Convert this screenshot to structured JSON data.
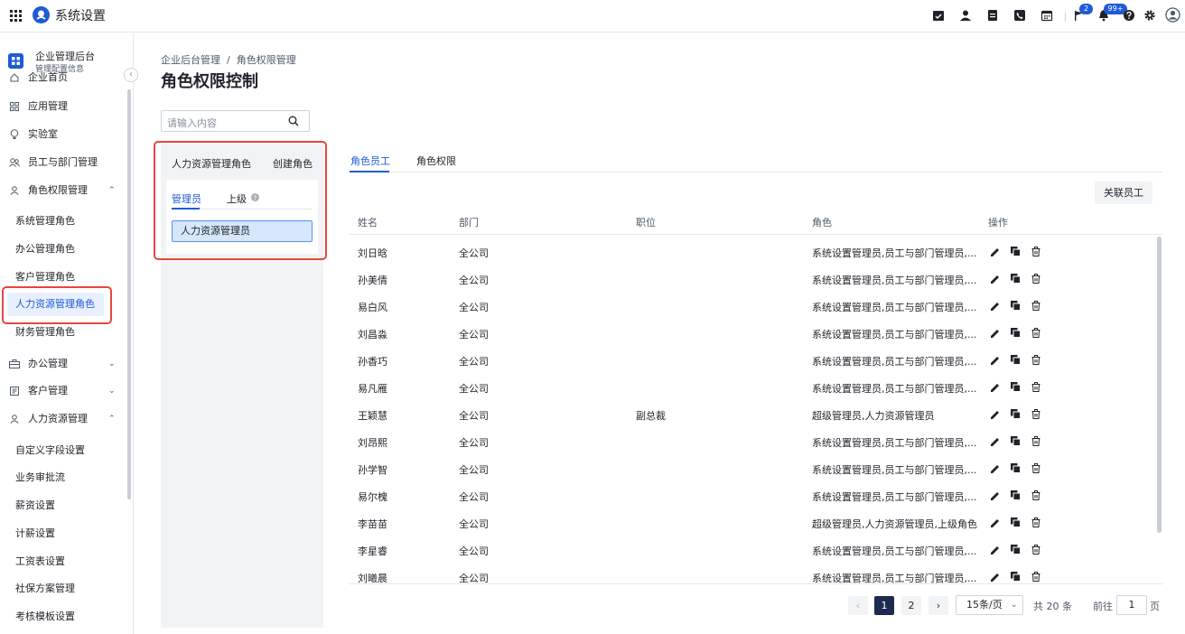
{
  "topbar": {
    "app_title": "系统设置",
    "icons": [
      "grid-icon",
      "logo-icon",
      "calendar-check-icon",
      "user-icon",
      "document-icon",
      "phone-icon",
      "calendar-icon",
      "flag-icon",
      "bell-icon",
      "help-icon",
      "gear-icon",
      "account-icon"
    ],
    "flag_badge": "2",
    "bell_badge": "99+",
    "accent": "#1f5bd6"
  },
  "sidebar": {
    "header_title": "企业管理后台",
    "header_sub": "管理配置信息",
    "items": [
      {
        "label": "企业首页",
        "icon": "home-icon"
      },
      {
        "label": "应用管理",
        "icon": "apps-icon"
      },
      {
        "label": "实验室",
        "icon": "bulb-icon"
      },
      {
        "label": "员工与部门管理",
        "icon": "users-icon"
      },
      {
        "label": "角色权限管理",
        "icon": "person-icon",
        "caret": "⌃"
      },
      {
        "label": "系统管理角色"
      },
      {
        "label": "办公管理角色"
      },
      {
        "label": "客户管理角色"
      },
      {
        "label": "人力资源管理角色"
      },
      {
        "label": "财务管理角色"
      },
      {
        "label": "办公管理",
        "icon": "office-icon",
        "caret": "⌄"
      },
      {
        "label": "客户管理",
        "icon": "customer-icon",
        "caret": "⌄"
      },
      {
        "label": "人力资源管理",
        "icon": "person-icon",
        "caret": "⌃"
      },
      {
        "label": "自定义字段设置"
      },
      {
        "label": "业务审批流"
      },
      {
        "label": "薪资设置"
      },
      {
        "label": "计薪设置"
      },
      {
        "label": "工资表设置"
      },
      {
        "label": "社保方案管理"
      },
      {
        "label": "考核模板设置"
      }
    ]
  },
  "main": {
    "breadcrumb": "企业后台管理  /  角色权限管理",
    "title": "角色权限控制",
    "search_placeholder": "请输入内容",
    "role_panel": {
      "title": "人力资源管理角色",
      "create_btn": "创建角色",
      "tab_admin": "管理员",
      "tab_superior": "上级",
      "selected_role": "人力资源管理员"
    },
    "tabs": [
      "角色员工",
      "角色权限"
    ],
    "assoc_btn": "关联员工",
    "columns": [
      "姓名",
      "部门",
      "职位",
      "角色",
      "操作"
    ],
    "rows": [
      {
        "name": "刘日晗",
        "dept": "全公司",
        "pos": "",
        "role": "系统设置管理员,员工与部门管理员,..."
      },
      {
        "name": "孙美倩",
        "dept": "全公司",
        "pos": "",
        "role": "系统设置管理员,员工与部门管理员,..."
      },
      {
        "name": "易白风",
        "dept": "全公司",
        "pos": "",
        "role": "系统设置管理员,员工与部门管理员,..."
      },
      {
        "name": "刘昌淼",
        "dept": "全公司",
        "pos": "",
        "role": "系统设置管理员,员工与部门管理员,..."
      },
      {
        "name": "孙香巧",
        "dept": "全公司",
        "pos": "",
        "role": "系统设置管理员,员工与部门管理员,..."
      },
      {
        "name": "易凡雁",
        "dept": "全公司",
        "pos": "",
        "role": "系统设置管理员,员工与部门管理员,..."
      },
      {
        "name": "王颖慧",
        "dept": "全公司",
        "pos": "副总裁",
        "role": "超级管理员,人力资源管理员"
      },
      {
        "name": "刘昂熙",
        "dept": "全公司",
        "pos": "",
        "role": "系统设置管理员,员工与部门管理员,..."
      },
      {
        "name": "孙学智",
        "dept": "全公司",
        "pos": "",
        "role": "系统设置管理员,员工与部门管理员,..."
      },
      {
        "name": "易尔槐",
        "dept": "全公司",
        "pos": "",
        "role": "系统设置管理员,员工与部门管理员,..."
      },
      {
        "name": "李苗苗",
        "dept": "全公司",
        "pos": "",
        "role": "超级管理员,人力资源管理员,上级角色"
      },
      {
        "name": "李星睿",
        "dept": "全公司",
        "pos": "",
        "role": "系统设置管理员,员工与部门管理员,..."
      },
      {
        "name": "刘曦晨",
        "dept": "全公司",
        "pos": "",
        "role": "系统设置管理员,员工与部门管理员,..."
      }
    ],
    "op_icons": [
      "edit-icon",
      "copy-icon",
      "delete-icon"
    ],
    "pagination": {
      "prev": "‹",
      "next": "›",
      "pages": [
        "1",
        "2"
      ],
      "current": "1",
      "page_size": "15条/页",
      "total": "共 20 条",
      "goto_label": "前往",
      "goto_value": "1",
      "page_suffix": "页"
    }
  }
}
